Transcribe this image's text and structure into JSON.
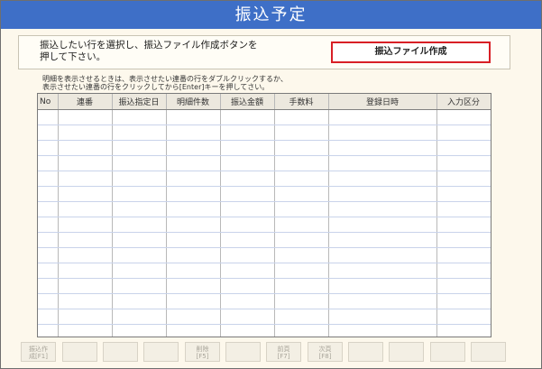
{
  "window": {
    "title": "振込予定"
  },
  "instruction": {
    "text": "振込したい行を選択し、振込ファイル作成ボタンを\n押して下さい。",
    "create_button_label": "振込ファイル作成"
  },
  "hint": {
    "text": "明細を表示させるときは、表示させたい連番の行をダブルクリックするか、\n表示させたい連番の行をクリックしてから[Enter]キーを押してさい。"
  },
  "table": {
    "columns": [
      "No",
      "連番",
      "振込指定日",
      "明細件数",
      "振込金額",
      "手数料",
      "登録日時",
      "入力区分"
    ],
    "rows": [
      [
        "",
        "",
        "",
        "",
        "",
        "",
        "",
        ""
      ],
      [
        "",
        "",
        "",
        "",
        "",
        "",
        "",
        ""
      ],
      [
        "",
        "",
        "",
        "",
        "",
        "",
        "",
        ""
      ],
      [
        "",
        "",
        "",
        "",
        "",
        "",
        "",
        ""
      ],
      [
        "",
        "",
        "",
        "",
        "",
        "",
        "",
        ""
      ],
      [
        "",
        "",
        "",
        "",
        "",
        "",
        "",
        ""
      ],
      [
        "",
        "",
        "",
        "",
        "",
        "",
        "",
        ""
      ],
      [
        "",
        "",
        "",
        "",
        "",
        "",
        "",
        ""
      ],
      [
        "",
        "",
        "",
        "",
        "",
        "",
        "",
        ""
      ],
      [
        "",
        "",
        "",
        "",
        "",
        "",
        "",
        ""
      ],
      [
        "",
        "",
        "",
        "",
        "",
        "",
        "",
        ""
      ],
      [
        "",
        "",
        "",
        "",
        "",
        "",
        "",
        ""
      ],
      [
        "",
        "",
        "",
        "",
        "",
        "",
        "",
        ""
      ],
      [
        "",
        "",
        "",
        "",
        "",
        "",
        "",
        ""
      ],
      [
        "",
        "",
        "",
        "",
        "",
        "",
        "",
        ""
      ]
    ]
  },
  "function_keys": [
    {
      "label": "振込作\n成[F1]"
    },
    {
      "label": ""
    },
    {
      "label": ""
    },
    {
      "label": ""
    },
    {
      "label": "削除\n[F5]"
    },
    {
      "label": ""
    },
    {
      "label": "前頁\n[F7]"
    },
    {
      "label": "次頁\n[F8]"
    },
    {
      "label": ""
    },
    {
      "label": ""
    },
    {
      "label": ""
    },
    {
      "label": ""
    }
  ]
}
